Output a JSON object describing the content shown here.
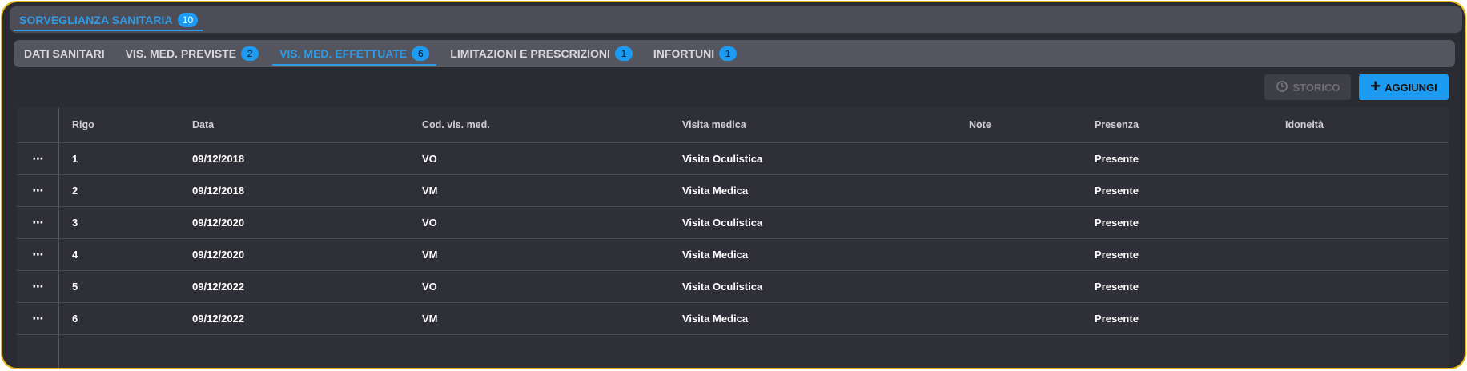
{
  "section": {
    "title": "SORVEGLIANZA SANITARIA",
    "count": "10"
  },
  "tabs": [
    {
      "label": "DATI SANITARI",
      "count": ""
    },
    {
      "label": "VIS. MED. PREVISTE",
      "count": "2"
    },
    {
      "label": "VIS. MED. EFFETTUATE",
      "count": "6"
    },
    {
      "label": "LIMITAZIONI E PRESCRIZIONI",
      "count": "1"
    },
    {
      "label": "INFORTUNI",
      "count": "1"
    }
  ],
  "toolbar": {
    "storico_label": "STORICO",
    "aggiungi_label": "AGGIUNGI",
    "aggiungi_icon": "plus-icon",
    "storico_icon": "history-icon"
  },
  "table": {
    "menu_glyph": "⋯",
    "columns": [
      "Rigo",
      "Data",
      "Cod. vis. med.",
      "Visita medica",
      "Note",
      "Presenza",
      "Idoneità"
    ],
    "rows": [
      {
        "rigo": "1",
        "data": "09/12/2018",
        "cod": "VO",
        "visita": "Visita Oculistica",
        "note": "",
        "presenza": "Presente",
        "idoneita": ""
      },
      {
        "rigo": "2",
        "data": "09/12/2018",
        "cod": "VM",
        "visita": "Visita Medica",
        "note": "",
        "presenza": "Presente",
        "idoneita": ""
      },
      {
        "rigo": "3",
        "data": "09/12/2020",
        "cod": "VO",
        "visita": "Visita Oculistica",
        "note": "",
        "presenza": "Presente",
        "idoneita": ""
      },
      {
        "rigo": "4",
        "data": "09/12/2020",
        "cod": "VM",
        "visita": "Visita Medica",
        "note": "",
        "presenza": "Presente",
        "idoneita": ""
      },
      {
        "rigo": "5",
        "data": "09/12/2022",
        "cod": "VO",
        "visita": "Visita Oculistica",
        "note": "",
        "presenza": "Presente",
        "idoneita": ""
      },
      {
        "rigo": "6",
        "data": "09/12/2022",
        "cod": "VM",
        "visita": "Visita Medica",
        "note": "",
        "presenza": "Presente",
        "idoneita": ""
      }
    ]
  },
  "colors": {
    "accent": "#1d9bf0",
    "frame_border": "#e8b81a",
    "background": "#2b2b34"
  }
}
